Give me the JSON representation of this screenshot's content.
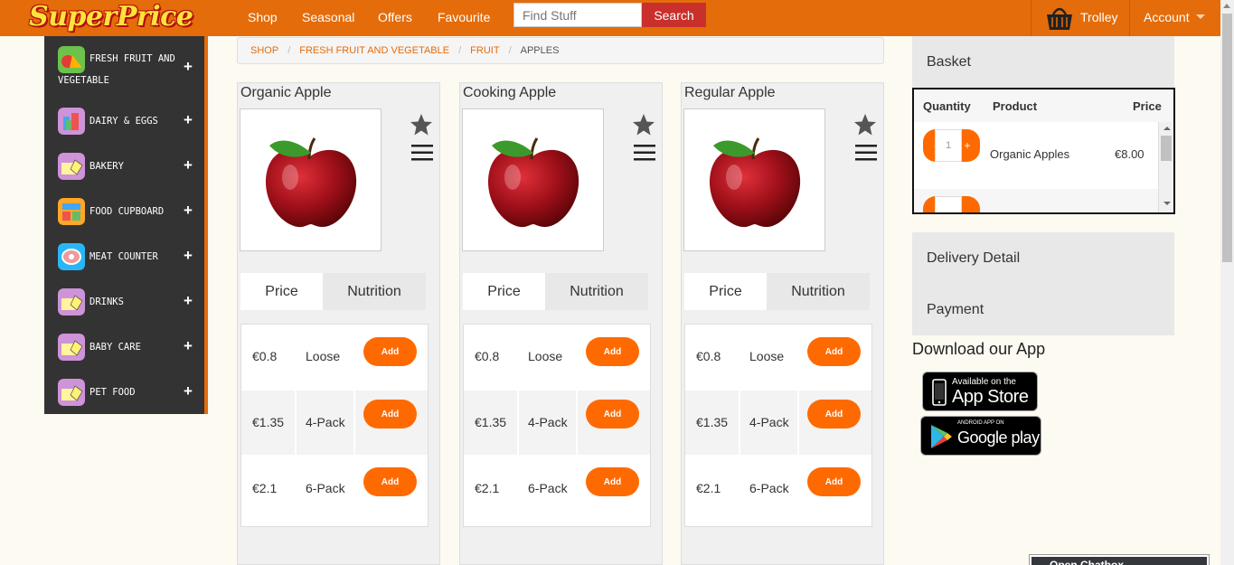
{
  "brand": {
    "name": "SuperPrice"
  },
  "nav": {
    "links": [
      "Shop",
      "Seasonal",
      "Offers",
      "Favourite"
    ],
    "search_placeholder": "Find Stuff",
    "search_button": "Search",
    "trolley": "Trolley",
    "account": "Account",
    "brand_color": "#e46c0a"
  },
  "sidebar": {
    "items": [
      {
        "label": "FRESH FRUIT AND",
        "label2": "VEGETABLE",
        "icon": "fruit-icon"
      },
      {
        "label": "DAIRY & EGGS",
        "icon": "dairy-icon"
      },
      {
        "label": "BAKERY",
        "icon": "bakery-icon"
      },
      {
        "label": "FOOD CUPBOARD",
        "icon": "cupboard-icon"
      },
      {
        "label": "MEAT COUNTER",
        "icon": "meat-icon"
      },
      {
        "label": "DRINKS",
        "icon": "drinks-icon"
      },
      {
        "label": "BABY CARE",
        "icon": "baby-icon"
      },
      {
        "label": "PET FOOD",
        "icon": "pet-icon"
      }
    ],
    "expand_symbol": "+"
  },
  "breadcrumb": {
    "shop": "SHOP",
    "category": "FRESH FRUIT AND VEGETABLE",
    "subcategory": "FRUIT",
    "current": "APPLES",
    "separator": "/"
  },
  "products": [
    {
      "name": "Organic Apple",
      "tab_price": "Price",
      "tab_nutrition": "Nutrition",
      "options": [
        {
          "price": "€0.8",
          "pack": "Loose",
          "button": "Add"
        },
        {
          "price": "€1.35",
          "pack": "4-Pack",
          "button": "Add"
        },
        {
          "price": "€2.1",
          "pack": "6-Pack",
          "button": "Add"
        }
      ]
    },
    {
      "name": "Cooking Apple",
      "tab_price": "Price",
      "tab_nutrition": "Nutrition",
      "options": [
        {
          "price": "€0.8",
          "pack": "Loose",
          "button": "Add"
        },
        {
          "price": "€1.35",
          "pack": "4-Pack",
          "button": "Add"
        },
        {
          "price": "€2.1",
          "pack": "6-Pack",
          "button": "Add"
        }
      ]
    },
    {
      "name": "Regular Apple",
      "tab_price": "Price",
      "tab_nutrition": "Nutrition",
      "options": [
        {
          "price": "€0.8",
          "pack": "Loose",
          "button": "Add"
        },
        {
          "price": "€1.35",
          "pack": "4-Pack",
          "button": "Add"
        },
        {
          "price": "€2.1",
          "pack": "6-Pack",
          "button": "Add"
        }
      ]
    }
  ],
  "basket": {
    "title": "Basket",
    "headers": {
      "quantity": "Quantity",
      "product": "Product",
      "price": "Price"
    },
    "items": [
      {
        "qty": "1",
        "product": "Organic Apples",
        "price": "€8.00",
        "minus": "-",
        "plus": "+"
      }
    ]
  },
  "right_panel": {
    "delivery": "Delivery Detail",
    "payment": "Payment",
    "download_title": "Download our App",
    "appstore_small": "Available on the",
    "appstore_big": "App Store",
    "googleplay_small": "ANDROID APP ON",
    "googleplay_big": "Google play"
  },
  "chatbox": {
    "label": "Open Chatbox"
  }
}
